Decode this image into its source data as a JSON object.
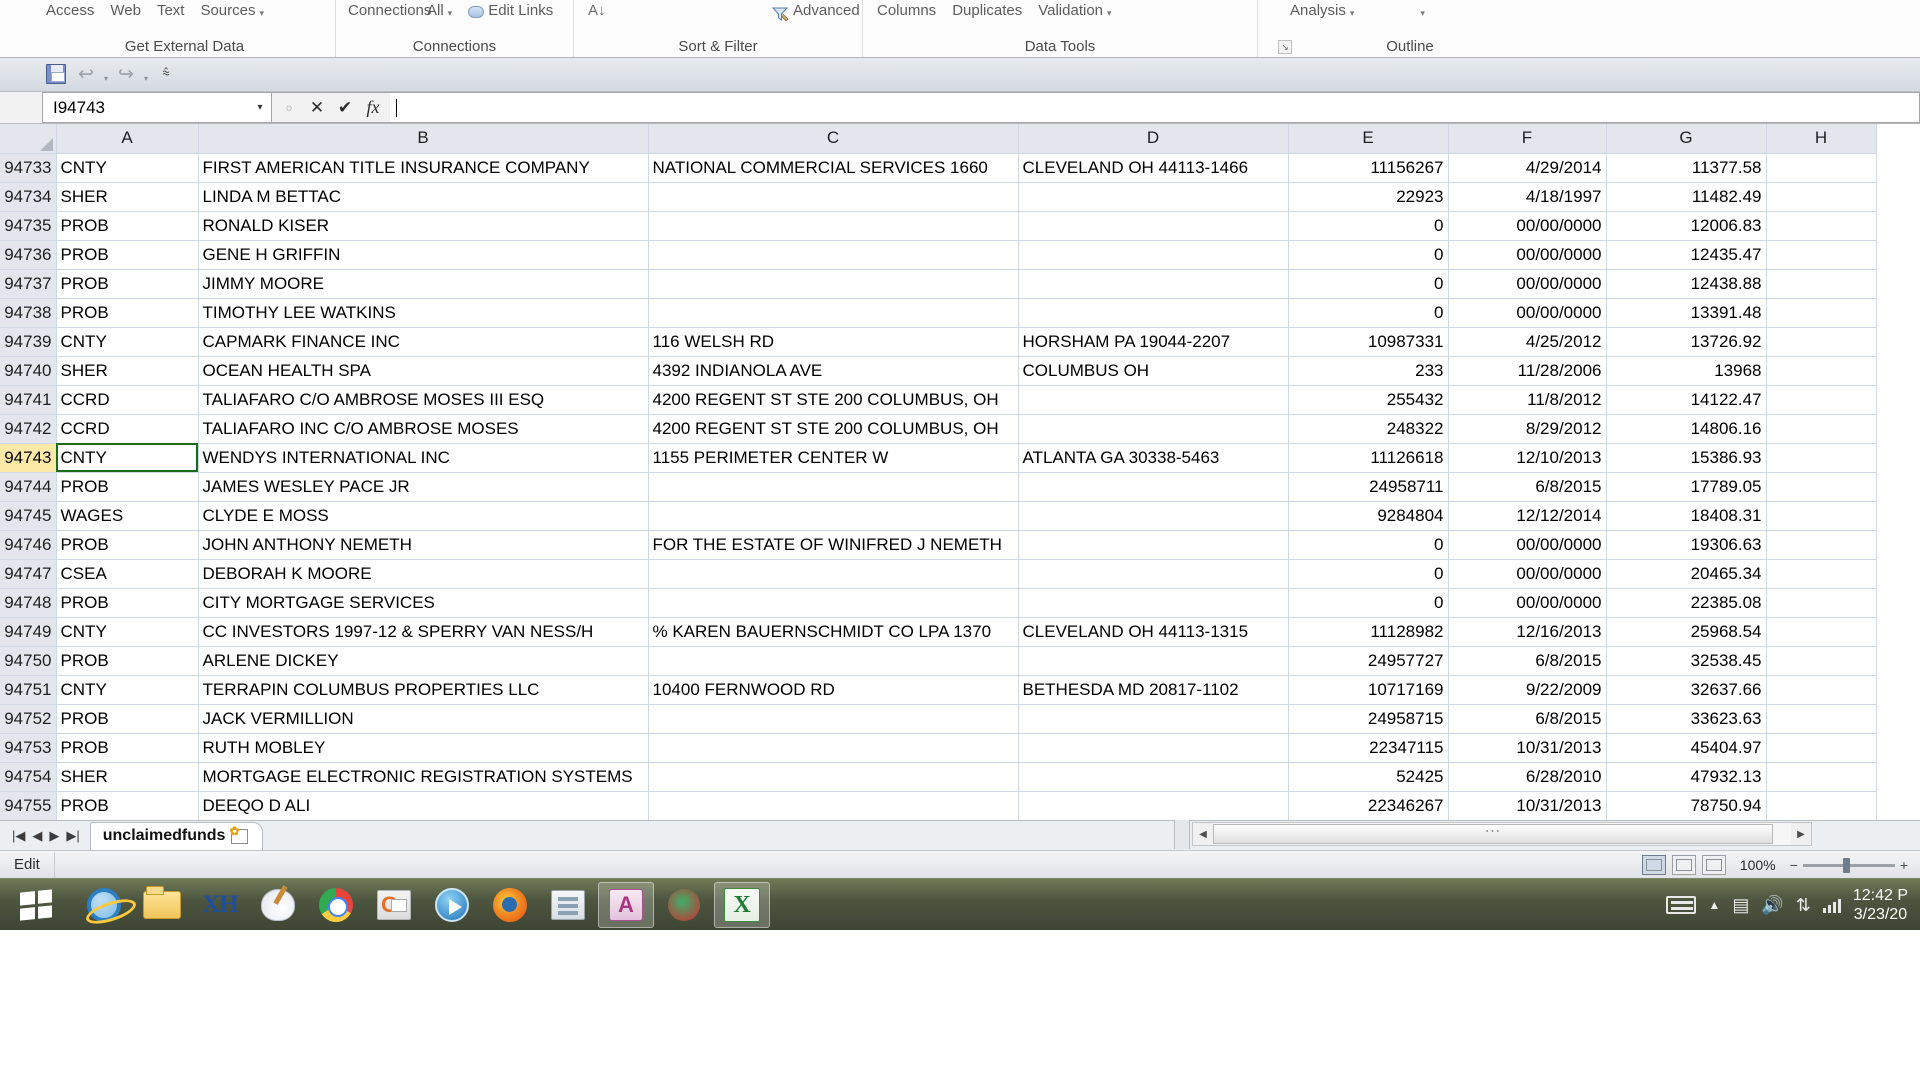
{
  "ribbon": {
    "groups": [
      {
        "label": "Get External Data",
        "buttons": [
          {
            "text": "Access",
            "caret": false
          },
          {
            "text": "Web",
            "caret": false
          },
          {
            "text": "Text",
            "caret": false
          },
          {
            "text": "Sources",
            "caret": true
          }
        ]
      },
      {
        "label": "Connections",
        "buttons": [
          {
            "text": "Connections",
            "caret": false
          },
          {
            "text": "All",
            "caret": true
          },
          {
            "text": "Edit Links",
            "caret": false
          }
        ]
      },
      {
        "label": "Sort & Filter",
        "buttons": [
          {
            "text": "Advanced",
            "caret": false
          }
        ],
        "sort_glyph": "A↓"
      },
      {
        "label": "Data Tools",
        "buttons": [
          {
            "text": "Columns",
            "caret": false
          },
          {
            "text": "Duplicates",
            "caret": false
          },
          {
            "text": "Validation",
            "caret": true
          }
        ]
      },
      {
        "label": "Outline",
        "buttons": [
          {
            "text": "Analysis",
            "caret": true
          }
        ]
      }
    ]
  },
  "quick_access": {
    "save_tooltip": "Save",
    "undo_tooltip": "Undo",
    "redo_tooltip": "Redo",
    "customize_tooltip": "Customize Quick Access Toolbar"
  },
  "formula_bar": {
    "name_box_value": "I94743",
    "cancel_glyph": "✕",
    "enter_glyph": "✔",
    "fx_glyph": "fx",
    "formula_value": ""
  },
  "grid": {
    "columns": [
      "A",
      "B",
      "C",
      "D",
      "E",
      "F",
      "G",
      "H"
    ],
    "selected_row_header": "94743",
    "rows": [
      {
        "h": "94733",
        "a": "CNTY",
        "b": "FIRST AMERICAN TITLE INSURANCE COMPANY",
        "c": "NATIONAL COMMERCIAL SERVICES 1660",
        "d": "CLEVELAND OH 44113-1466",
        "e": "11156267",
        "f": "4/29/2014",
        "g": "11377.58"
      },
      {
        "h": "94734",
        "a": "SHER",
        "b": "LINDA M BETTAC",
        "c": "",
        "d": "",
        "e": "22923",
        "f": "4/18/1997",
        "g": "11482.49"
      },
      {
        "h": "94735",
        "a": "PROB",
        "b": "RONALD KISER",
        "c": "",
        "d": "",
        "e": "0",
        "f": "00/00/0000",
        "g": "12006.83"
      },
      {
        "h": "94736",
        "a": "PROB",
        "b": "GENE H GRIFFIN",
        "c": "",
        "d": "",
        "e": "0",
        "f": "00/00/0000",
        "g": "12435.47"
      },
      {
        "h": "94737",
        "a": "PROB",
        "b": "JIMMY MOORE",
        "c": "",
        "d": "",
        "e": "0",
        "f": "00/00/0000",
        "g": "12438.88"
      },
      {
        "h": "94738",
        "a": "PROB",
        "b": "TIMOTHY LEE WATKINS",
        "c": "",
        "d": "",
        "e": "0",
        "f": "00/00/0000",
        "g": "13391.48"
      },
      {
        "h": "94739",
        "a": "CNTY",
        "b": "CAPMARK FINANCE INC",
        "c": "116 WELSH RD",
        "d": "HORSHAM PA 19044-2207",
        "e": "10987331",
        "f": "4/25/2012",
        "g": "13726.92"
      },
      {
        "h": "94740",
        "a": "SHER",
        "b": "OCEAN HEALTH SPA",
        "c": "4392 INDIANOLA AVE",
        "d": "COLUMBUS OH",
        "e": "233",
        "f": "11/28/2006",
        "g": "13968"
      },
      {
        "h": "94741",
        "a": "CCRD",
        "b": "TALIAFARO C/O AMBROSE MOSES III ESQ",
        "c": "4200 REGENT ST STE 200 COLUMBUS, OH",
        "d": "",
        "e": "255432",
        "f": "11/8/2012",
        "g": "14122.47"
      },
      {
        "h": "94742",
        "a": "CCRD",
        "b": "TALIAFARO INC C/O AMBROSE MOSES",
        "c": "4200 REGENT ST STE 200 COLUMBUS, OH",
        "d": "",
        "e": "248322",
        "f": "8/29/2012",
        "g": "14806.16"
      },
      {
        "h": "94743",
        "a": "CNTY",
        "b": "WENDYS INTERNATIONAL INC",
        "c": "1155 PERIMETER CENTER W",
        "d": "ATLANTA GA 30338-5463",
        "e": "11126618",
        "f": "12/10/2013",
        "g": "15386.93"
      },
      {
        "h": "94744",
        "a": "PROB",
        "b": "JAMES WESLEY PACE JR",
        "c": "",
        "d": "",
        "e": "24958711",
        "f": "6/8/2015",
        "g": "17789.05"
      },
      {
        "h": "94745",
        "a": "WAGES",
        "b": "CLYDE E MOSS",
        "c": "",
        "d": "",
        "e": "9284804",
        "f": "12/12/2014",
        "g": "18408.31"
      },
      {
        "h": "94746",
        "a": "PROB",
        "b": "JOHN ANTHONY NEMETH",
        "c": "FOR THE ESTATE OF WINIFRED J NEMETH",
        "d": "",
        "e": "0",
        "f": "00/00/0000",
        "g": "19306.63"
      },
      {
        "h": "94747",
        "a": "CSEA",
        "b": "DEBORAH K MOORE",
        "c": "",
        "d": "",
        "e": "0",
        "f": "00/00/0000",
        "g": "20465.34"
      },
      {
        "h": "94748",
        "a": "PROB",
        "b": "CITY MORTGAGE SERVICES",
        "c": "",
        "d": "",
        "e": "0",
        "f": "00/00/0000",
        "g": "22385.08"
      },
      {
        "h": "94749",
        "a": "CNTY",
        "b": "CC INVESTORS 1997-12 & SPERRY VAN NESS/H",
        "c": "% KAREN BAUERNSCHMIDT CO LPA 1370",
        "d": "CLEVELAND OH 44113-1315",
        "e": "11128982",
        "f": "12/16/2013",
        "g": "25968.54"
      },
      {
        "h": "94750",
        "a": "PROB",
        "b": "ARLENE DICKEY",
        "c": "",
        "d": "",
        "e": "24957727",
        "f": "6/8/2015",
        "g": "32538.45"
      },
      {
        "h": "94751",
        "a": "CNTY",
        "b": "TERRAPIN COLUMBUS PROPERTIES LLC",
        "c": "10400 FERNWOOD RD",
        "d": "BETHESDA MD 20817-1102",
        "e": "10717169",
        "f": "9/22/2009",
        "g": "32637.66"
      },
      {
        "h": "94752",
        "a": "PROB",
        "b": "JACK VERMILLION",
        "c": "",
        "d": "",
        "e": "24958715",
        "f": "6/8/2015",
        "g": "33623.63"
      },
      {
        "h": "94753",
        "a": "PROB",
        "b": "RUTH MOBLEY",
        "c": "",
        "d": "",
        "e": "22347115",
        "f": "10/31/2013",
        "g": "45404.97"
      },
      {
        "h": "94754",
        "a": "SHER",
        "b": "MORTGAGE ELECTRONIC REGISTRATION SYSTEMS",
        "c": "",
        "d": "",
        "e": "52425",
        "f": "6/28/2010",
        "g": "47932.13"
      },
      {
        "h": "94755",
        "a": "PROB",
        "b": "DEEQO D ALI",
        "c": "",
        "d": "",
        "e": "22346267",
        "f": "10/31/2013",
        "g": "78750.94"
      }
    ]
  },
  "sheet_tabs": {
    "first_glyph": "|◀",
    "prev_glyph": "◀",
    "next_glyph": "▶",
    "last_glyph": "▶|",
    "active_tab": "unclaimedfunds"
  },
  "status_bar": {
    "mode": "Edit",
    "zoom_level": "100%",
    "view_normal_tooltip": "Normal",
    "view_layout_tooltip": "Page Layout",
    "view_break_tooltip": "Page Break Preview"
  },
  "taskbar": {
    "start_tooltip": "Start",
    "items": [
      {
        "name": "internet-explorer",
        "label": "Internet Explorer"
      },
      {
        "name": "file-explorer",
        "label": "Windows Explorer"
      },
      {
        "name": "xh-app",
        "label": "XH"
      },
      {
        "name": "paint",
        "label": "Paint"
      },
      {
        "name": "chrome",
        "label": "Google Chrome"
      },
      {
        "name": "outlook",
        "label": "Outlook"
      },
      {
        "name": "media-player",
        "label": "Windows Media Player"
      },
      {
        "name": "firefox",
        "label": "Mozilla Firefox"
      },
      {
        "name": "generic-app",
        "label": "Application"
      },
      {
        "name": "access",
        "label": "Microsoft Access"
      },
      {
        "name": "opera",
        "label": "Opera"
      },
      {
        "name": "excel",
        "label": "Microsoft Excel"
      }
    ],
    "clock_time": "12:42 P",
    "clock_date": "3/23/20"
  }
}
